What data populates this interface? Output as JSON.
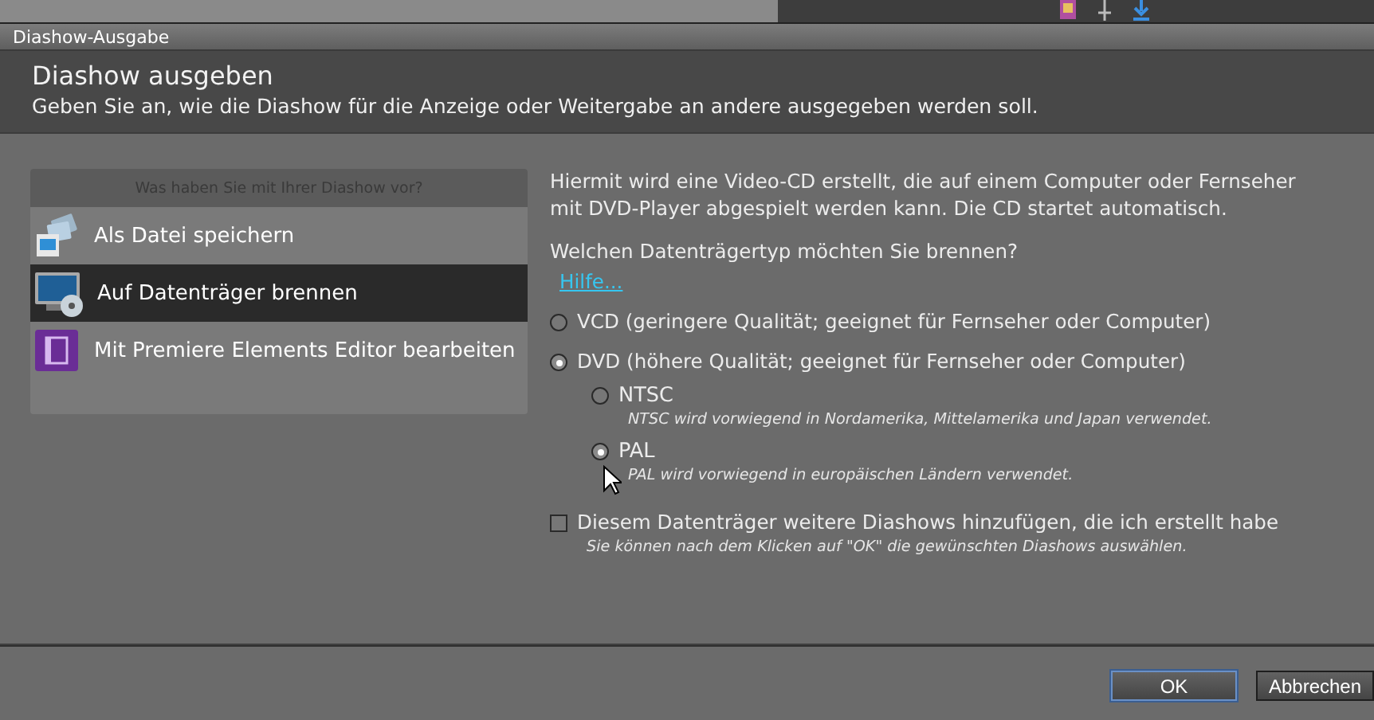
{
  "window": {
    "title": "Diashow-Ausgabe"
  },
  "header": {
    "title": "Diashow ausgeben",
    "subtitle": "Geben Sie an, wie die Diashow für die Anzeige oder Weitergabe an andere ausgegeben werden soll."
  },
  "sidebar": {
    "heading": "Was haben Sie mit Ihrer Diashow vor?",
    "items": [
      {
        "label": "Als Datei speichern",
        "kind": "file",
        "selected": false
      },
      {
        "label": "Auf Datenträger brennen",
        "kind": "disc",
        "selected": true
      },
      {
        "label": "Mit Premiere Elements Editor bearbeiten",
        "kind": "editor",
        "selected": false
      }
    ]
  },
  "content": {
    "description": "Hiermit wird eine Video-CD erstellt, die auf einem Computer oder Fernseher mit DVD-Player abgespielt werden kann. Die CD startet automatisch.",
    "question": "Welchen Datenträgertyp möchten Sie brennen?",
    "help_link": "Hilfe...",
    "disc_types": [
      {
        "label": "VCD (geringere Qualität; geeignet für Fernseher oder Computer)",
        "selected": false
      },
      {
        "label": "DVD (höhere Qualität; geeignet für Fernseher oder Computer)",
        "selected": true,
        "children": [
          {
            "label": "NTSC",
            "hint": "NTSC wird vorwiegend in Nordamerika, Mittelamerika und Japan verwendet.",
            "selected": false
          },
          {
            "label": "PAL",
            "hint": "PAL wird vorwiegend in europäischen Ländern verwendet.",
            "selected": true
          }
        ]
      }
    ],
    "add_more": {
      "label": "Diesem Datenträger weitere Diashows hinzufügen, die ich erstellt habe",
      "hint": "Sie können nach dem Klicken auf \"OK\" die gewünschten Diashows auswählen.",
      "checked": false
    }
  },
  "buttons": [
    {
      "label": "OK",
      "kind": "default"
    },
    {
      "label": "Abbrechen",
      "kind": "normal"
    }
  ]
}
